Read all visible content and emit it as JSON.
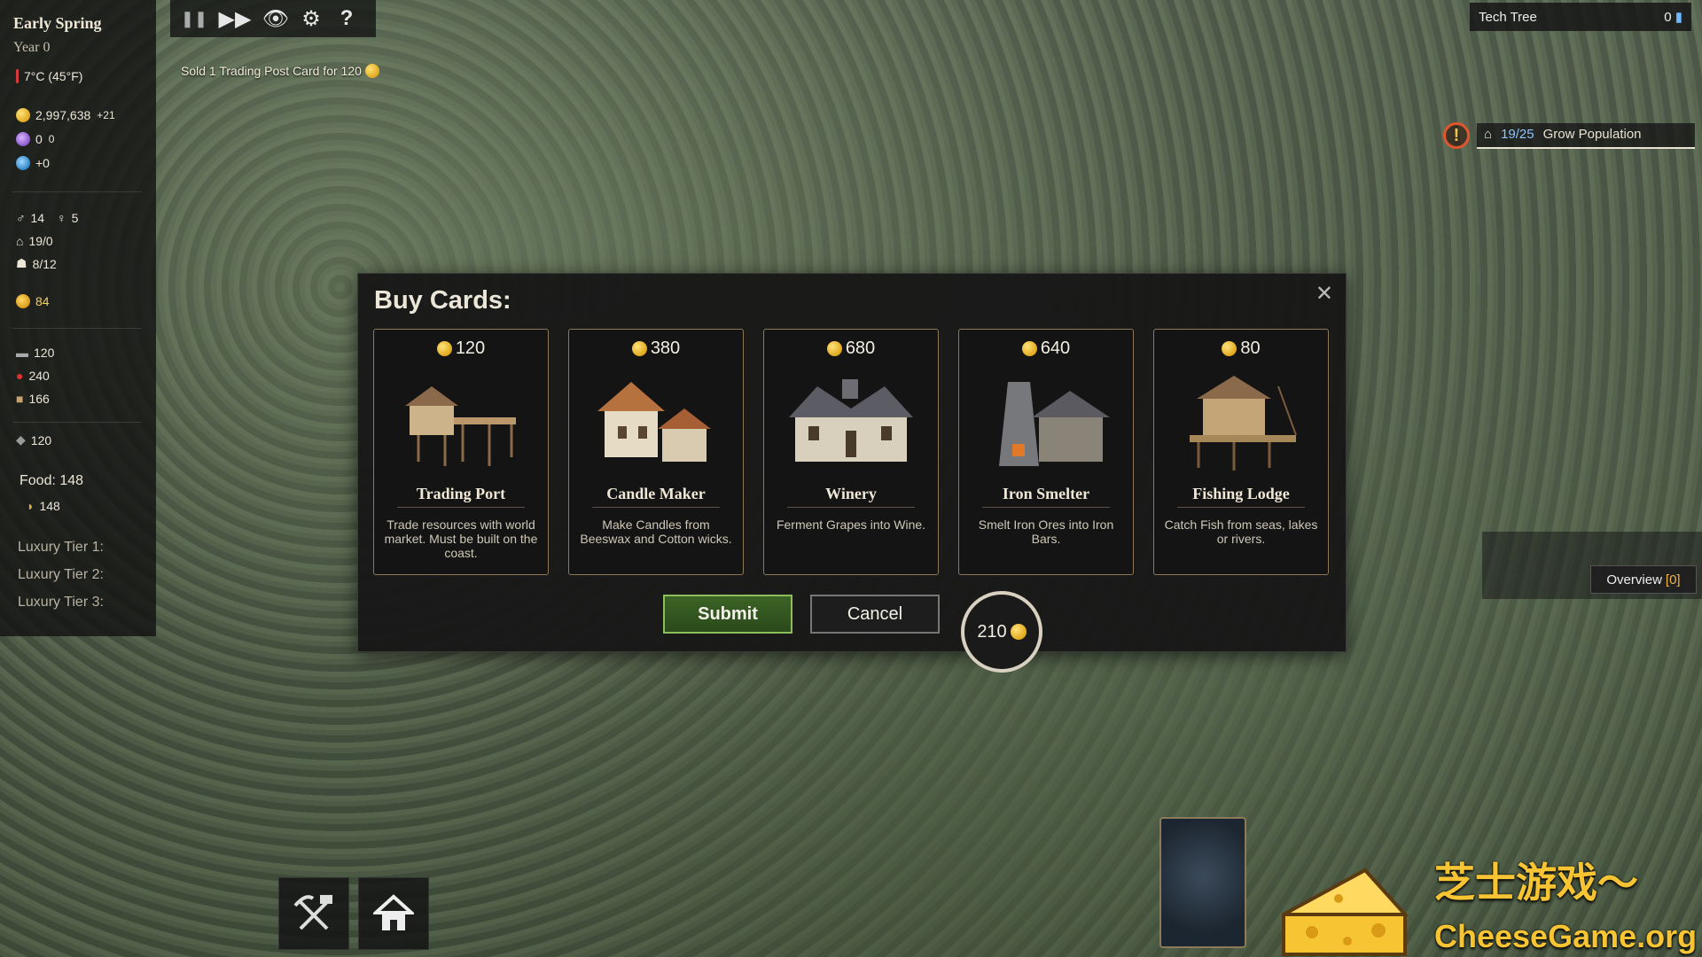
{
  "stats": {
    "season": "Early Spring",
    "year": "Year 0",
    "temperature": "7°C (45°F)",
    "gold": "2,997,638",
    "gold_delta": "+21",
    "purple": "0",
    "purple_delta": "0",
    "water": "+0",
    "male": "14",
    "female": "5",
    "housing": "19/0",
    "workers": "8/12",
    "happiness": "84",
    "res1": "120",
    "res2": "240",
    "res3": "166",
    "res4": "120",
    "food_label": "Food: 148",
    "food_item": "148",
    "lux1": "Luxury Tier 1:",
    "lux2": "Luxury Tier 2:",
    "lux3": "Luxury Tier 3:"
  },
  "topbar": {
    "pause": "❚❚",
    "fast": "▶▶",
    "eye": "👁",
    "gear": "⚙",
    "help": "?"
  },
  "notification": "Sold 1 Trading Post Card for 120",
  "tech_tree": {
    "label": "Tech Tree",
    "count": "0"
  },
  "quest": {
    "progress": "19/25",
    "label": "Grow Population",
    "alert": "!"
  },
  "overview": {
    "label": "Overview",
    "count": "[0]"
  },
  "dialog": {
    "title": "Buy Cards:",
    "close": "✕",
    "submit": "Submit",
    "cancel": "Cancel",
    "reroll_cost": "210",
    "cards": [
      {
        "price": "120",
        "name": "Trading Port",
        "desc": "Trade resources with world market. Must be built on the coast.",
        "color": "#cdb38a"
      },
      {
        "price": "380",
        "name": "Candle Maker",
        "desc": "Make Candles from Beeswax and Cotton wicks.",
        "color": "#b5713e"
      },
      {
        "price": "680",
        "name": "Winery",
        "desc": "Ferment Grapes into Wine.",
        "color": "#6c6c72"
      },
      {
        "price": "640",
        "name": "Iron Smelter",
        "desc": "Smelt Iron Ores into Iron Bars.",
        "color": "#77787c"
      },
      {
        "price": "80",
        "name": "Fishing Lodge",
        "desc": "Catch Fish from seas, lakes or rivers.",
        "color": "#c4a578"
      }
    ]
  },
  "watermark": {
    "cn": "芝士游戏～",
    "en": "CheeseGame.org"
  },
  "colors": {
    "gold": "#e0a81c",
    "submit_green": "#3c6326",
    "card_border": "#8c7a5a",
    "quest_blue": "#8fc3ff"
  }
}
